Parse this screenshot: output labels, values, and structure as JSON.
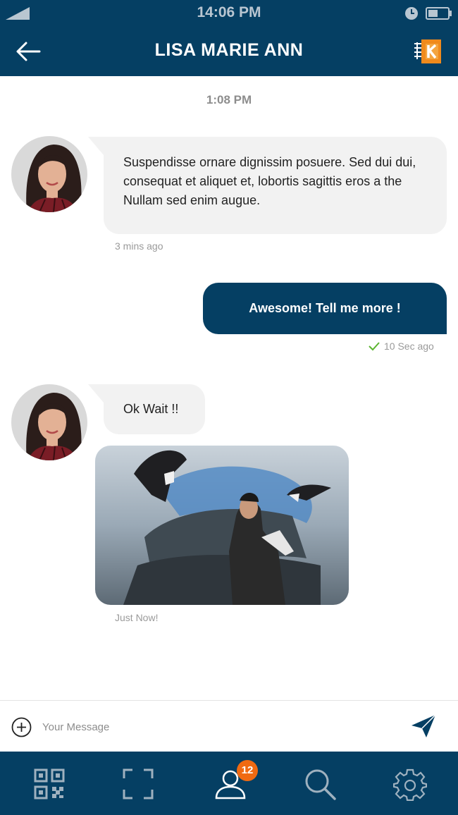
{
  "status_bar": {
    "time": "14:06 PM"
  },
  "header": {
    "title": "LISA MARIE ANN",
    "back_icon": "back-arrow-icon",
    "logo": "brand-logo"
  },
  "chat": {
    "day_time": "1:08 PM",
    "messages": [
      {
        "from": "contact",
        "type": "text",
        "text": "Suspendisse ornare dignissim posuere. Sed dui dui, consequat et aliquet et, lobortis sagittis eros a the Nullam sed enim augue.",
        "time": "3 mins ago"
      },
      {
        "from": "me",
        "type": "text",
        "text": "Awesome! Tell me more !",
        "time": "10 Sec ago",
        "status": "delivered"
      },
      {
        "from": "contact",
        "type": "text",
        "text": "Ok Wait !!"
      },
      {
        "from": "contact",
        "type": "image",
        "time": "Just Now!"
      }
    ]
  },
  "composer": {
    "placeholder": "Your Message",
    "value": ""
  },
  "bottom_nav": {
    "items": [
      {
        "icon": "qr-code-icon"
      },
      {
        "icon": "scan-frame-icon"
      },
      {
        "icon": "user-icon",
        "badge": "12"
      },
      {
        "icon": "search-icon"
      },
      {
        "icon": "gear-icon"
      }
    ]
  },
  "colors": {
    "primary": "#053f63",
    "badge": "#f06a12",
    "bubble_incoming": "#f2f2f2",
    "check": "#5cb531"
  }
}
